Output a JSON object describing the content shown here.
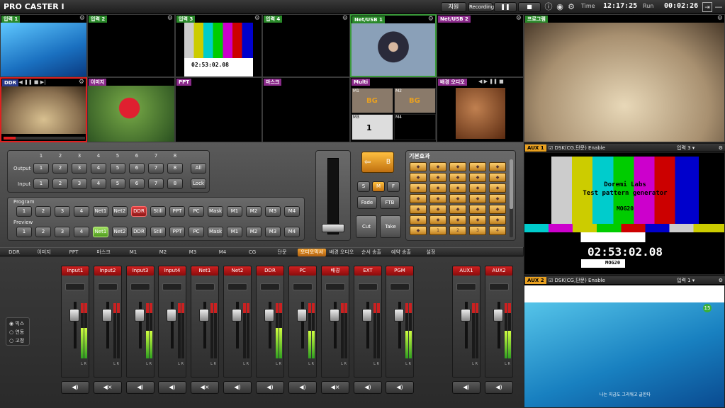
{
  "app_title": "PRO CASTER Ⅰ",
  "titlebar": {
    "support_label": "지원",
    "recording_label": "Recording",
    "time_label": "Time",
    "time_value": "12:17:25",
    "run_label": "Run",
    "run_value": "00:02:26"
  },
  "tiles": [
    {
      "label": "입력 1",
      "tag_color": "#2a8a2a"
    },
    {
      "label": "입력 2",
      "tag_color": "#2a8a2a"
    },
    {
      "label": "입력 3",
      "tag_color": "#2a8a2a"
    },
    {
      "label": "입력 4",
      "tag_color": "#2a8a2a"
    },
    {
      "label": "Net/USB 1",
      "tag_color": "#2a8a2a"
    },
    {
      "label": "Net/USB 2",
      "tag_color": "#8a2a8a"
    },
    {
      "label": "DDR",
      "tag_color": "#2a3a8a"
    },
    {
      "label": "이미지",
      "tag_color": "#8a2a8a"
    },
    {
      "label": "PPT",
      "tag_color": "#8a2a8a"
    },
    {
      "label": "마스크",
      "tag_color": "#8a2a8a"
    },
    {
      "label": "Multi",
      "tag_color": "#8a2a8a"
    },
    {
      "label": "배경 오디오",
      "tag_color": "#8a2a8a"
    }
  ],
  "input3_timecode": "02:53:02.08",
  "multi": {
    "bg1": "BG",
    "bg2": "BG",
    "m1": "M1",
    "m2": "M2",
    "m3": "M3",
    "m4": "M4",
    "num": "1"
  },
  "program_monitor_label": "프로그램",
  "router": {
    "columns": [
      "1",
      "2",
      "3",
      "4",
      "5",
      "6",
      "7",
      "8"
    ],
    "output_label": "Output",
    "input_label": "Input",
    "output_keys": [
      "1",
      "2",
      "3",
      "4",
      "5",
      "6",
      "7",
      "8"
    ],
    "input_keys": [
      "1",
      "2",
      "3",
      "4",
      "5",
      "6",
      "7",
      "8"
    ],
    "all_label": "All",
    "lock_label": "Lock"
  },
  "program_label": "Program",
  "preview_label": "Preview",
  "program_keys": [
    "1",
    "2",
    "3",
    "4",
    "Net1",
    "Net2",
    "DDR",
    "Still",
    "PPT",
    "PC",
    "Mask",
    "M1",
    "M2",
    "M3",
    "M4"
  ],
  "preview_keys": [
    "1",
    "2",
    "3",
    "4",
    "Net1",
    "Net2",
    "DDR",
    "Still",
    "PPT",
    "PC",
    "Mask",
    "M1",
    "M2",
    "M3",
    "M4"
  ],
  "program_selected": "DDR",
  "preview_selected": "Net1",
  "transition": {
    "b_label": "B",
    "s": "S",
    "m": "M",
    "f": "F",
    "fade": "Fade",
    "ftb": "FTB",
    "cut": "Cut",
    "take": "Take"
  },
  "effects_title": "기본효과",
  "effects_labels": [
    "1",
    "2",
    "3",
    "4"
  ],
  "tabs": [
    "DDR",
    "이미지",
    "PPT",
    "마스크",
    "M1",
    "M2",
    "M3",
    "M4",
    "CG",
    "단문",
    "오디오믹서",
    "배경 오디오",
    "순서 송출",
    "예약 송출",
    "설정"
  ],
  "active_tab": "오디오믹서",
  "mode_options": [
    "믹스",
    "연동",
    "고정"
  ],
  "mode_selected": "믹스",
  "channels": [
    {
      "name": "Input1",
      "level": 0.55,
      "mute": "◀)"
    },
    {
      "name": "Input2",
      "level": 0.0,
      "mute": "◀×"
    },
    {
      "name": "Input3",
      "level": 0.5,
      "mute": "◀)"
    },
    {
      "name": "Input4",
      "level": 0.0,
      "mute": "◀)"
    },
    {
      "name": "Net1",
      "level": 0.0,
      "mute": "◀×"
    },
    {
      "name": "Net2",
      "level": 0.0,
      "mute": "◀)"
    },
    {
      "name": "DDR",
      "level": 0.55,
      "mute": "◀)"
    },
    {
      "name": "PC",
      "level": 0.5,
      "mute": "◀)"
    },
    {
      "name": "배경",
      "level": 0.0,
      "mute": "◀×"
    },
    {
      "name": "EXT",
      "level": 0.0,
      "mute": "◀)"
    },
    {
      "name": "PGM",
      "level": 0.5,
      "mute": "◀)"
    },
    {
      "name": "AUX1",
      "level": 0.0,
      "mute": "◀)"
    },
    {
      "name": "AUX2",
      "level": 0.5,
      "mute": "◀)"
    }
  ],
  "lr_label": "L R",
  "aux1": {
    "tag": "AUX 1",
    "dsk": "DSK(CG,단문) Enable",
    "source": "입력 3",
    "line1": "Doremi Labs",
    "line2": "Test pattern generator",
    "line3": "MOG20",
    "timecode": "02:53:02.08",
    "bottom": "Doremi Labs",
    "bottom2": "MOG20"
  },
  "aux2": {
    "tag": "AUX 2",
    "dsk": "DSK(CG,단문) Enable",
    "source": "입력 1",
    "badge": "15",
    "caption": "나는 지금도 그리워고 글한다"
  }
}
